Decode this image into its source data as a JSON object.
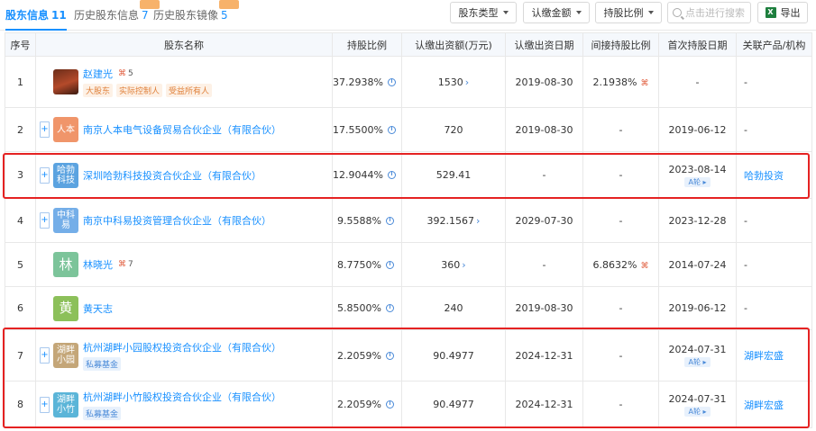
{
  "tabs": [
    {
      "label": "股东信息",
      "count": "11",
      "active": true
    },
    {
      "label": "历史股东信息",
      "count": "7",
      "active": false
    },
    {
      "label": "历史股东镜像",
      "count": "5",
      "active": false
    }
  ],
  "toolbar": {
    "type_label": "股东类型",
    "amount_label": "认缴金额",
    "ratio_label": "持股比例",
    "search_placeholder": "点击进行搜索",
    "export_label": "导出",
    "excel_glyph": "X"
  },
  "columns": [
    "序号",
    "股东名称",
    "持股比例",
    "认缴出资额(万元)",
    "认缴出资日期",
    "间接持股比例",
    "首次持股日期",
    "关联产品/机构"
  ],
  "rows": [
    {
      "idx": "1",
      "name": "赵建光",
      "logo": "",
      "relcount": "5",
      "tags": [
        "大股东",
        "实际控制人",
        "受益所有人"
      ],
      "ratio": "37.2938%",
      "amount": "1530",
      "amount_more": true,
      "date": "2019-08-30",
      "indirect": "2.1938%",
      "indirect_icon": true,
      "first": "-",
      "round": "",
      "assoc": "-"
    },
    {
      "idx": "2",
      "name": "南京人本电气设备贸易合伙企业（有限合伙）",
      "logo": "人本",
      "logo_color": "#f0956a",
      "relcount": "",
      "tags": [],
      "ratio": "17.5500%",
      "amount": "720",
      "amount_more": false,
      "date": "2019-08-30",
      "indirect": "-",
      "indirect_icon": false,
      "first": "2019-06-12",
      "round": "",
      "assoc": "-"
    },
    {
      "idx": "3",
      "name": "深圳哈勃科技投资合伙企业（有限合伙）",
      "logo": "哈勃 科技",
      "logo_color": "#5ba3e0",
      "relcount": "",
      "tags": [],
      "ratio": "12.9044%",
      "amount": "529.41",
      "amount_more": false,
      "date": "-",
      "indirect": "-",
      "indirect_icon": false,
      "first": "2023-08-14",
      "round": "A轮",
      "assoc": "哈勃投资"
    },
    {
      "idx": "4",
      "name": "南京中科易投资管理合伙企业（有限合伙）",
      "logo": "中科 易",
      "logo_color": "#74aee8",
      "relcount": "",
      "tags": [],
      "ratio": "9.5588%",
      "amount": "392.1567",
      "amount_more": true,
      "date": "2029-07-30",
      "indirect": "-",
      "indirect_icon": false,
      "first": "2023-12-28",
      "round": "",
      "assoc": "-"
    },
    {
      "idx": "5",
      "name": "林晓光",
      "logo": "林",
      "logo_color": "#7cc49a",
      "relcount": "7",
      "tags": [],
      "ratio": "8.7750%",
      "amount": "360",
      "amount_more": true,
      "date": "-",
      "indirect": "6.8632%",
      "indirect_icon": true,
      "first": "2014-07-24",
      "round": "",
      "assoc": "-"
    },
    {
      "idx": "6",
      "name": "黄天志",
      "logo": "黄",
      "logo_color": "#8cc05a",
      "relcount": "",
      "tags": [],
      "ratio": "5.8500%",
      "amount": "240",
      "amount_more": false,
      "date": "2019-08-30",
      "indirect": "-",
      "indirect_icon": false,
      "first": "2019-06-12",
      "round": "",
      "assoc": "-"
    },
    {
      "idx": "7",
      "name": "杭州湖畔小园股权投资合伙企业（有限合伙）",
      "logo": "湖畔 小园",
      "logo_color": "#c4a678",
      "relcount": "",
      "tags": [
        "私募基金"
      ],
      "ratio": "2.2059%",
      "amount": "90.4977",
      "amount_more": false,
      "date": "2024-12-31",
      "indirect": "-",
      "indirect_icon": false,
      "first": "2024-07-31",
      "round": "A轮",
      "assoc": "湖畔宏盛"
    },
    {
      "idx": "8",
      "name": "杭州湖畔小竹股权投资合伙企业（有限合伙）",
      "logo": "湖畔 小竹",
      "logo_color": "#5bb5d8",
      "relcount": "",
      "tags": [
        "私募基金"
      ],
      "ratio": "2.2059%",
      "amount": "90.4977",
      "amount_more": false,
      "date": "2024-12-31",
      "indirect": "-",
      "indirect_icon": false,
      "first": "2024-07-31",
      "round": "A轮",
      "assoc": "湖畔宏盛"
    }
  ]
}
